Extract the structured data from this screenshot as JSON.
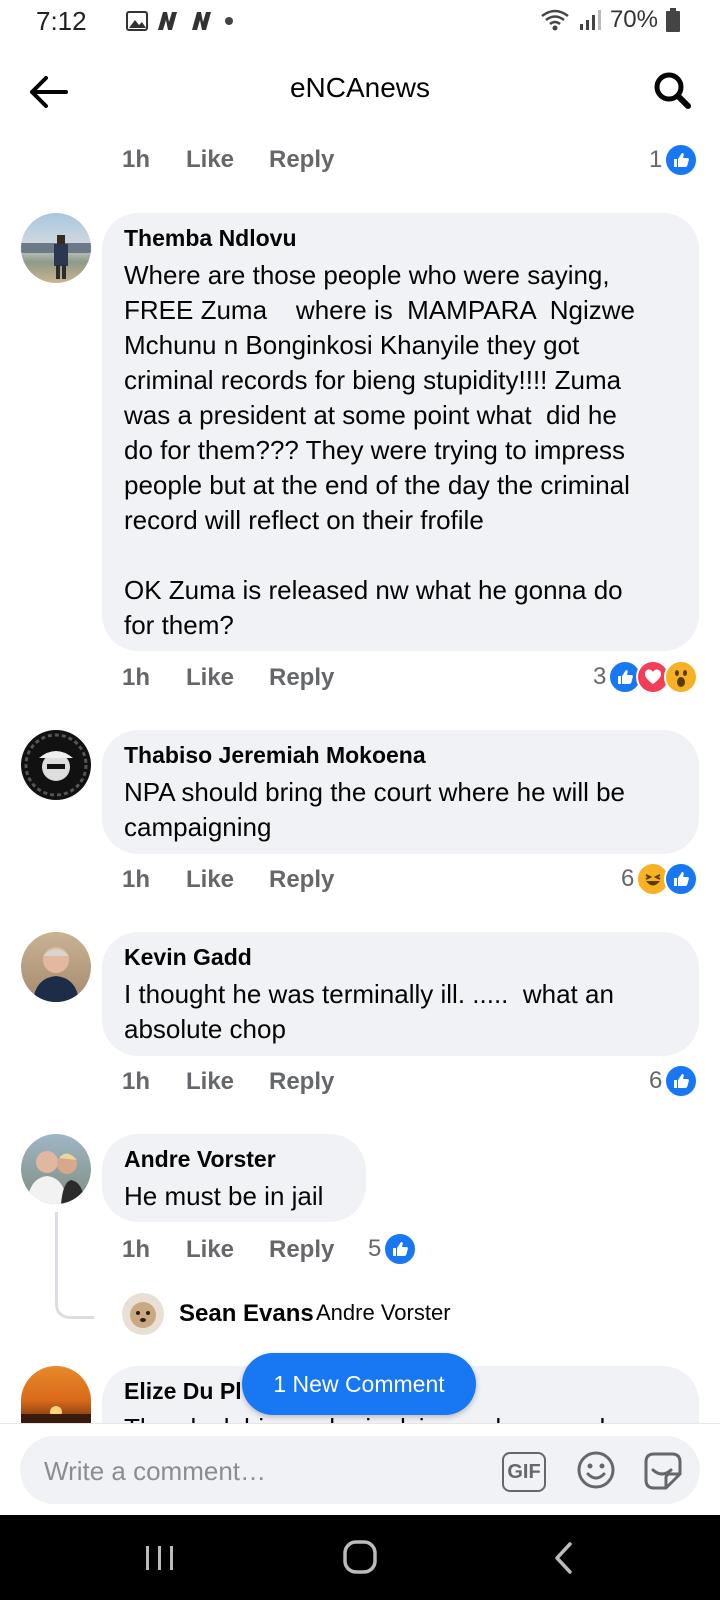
{
  "status_bar": {
    "time": "7:12",
    "battery": "70%"
  },
  "header": {
    "title": "eNCAnews"
  },
  "actions": {
    "like_label": "Like",
    "reply_label": "Reply"
  },
  "top_meta": {
    "time": "1h",
    "reaction_count": "1"
  },
  "comments": [
    {
      "author": "Themba Ndlovu",
      "text": "Where are those people who were saying,\nFREE Zuma    where is  MAMPARA  Ngizwe\nMchunu n Bonginkosi Khanyile they got\ncriminal records for bieng stupidity!!!! Zuma\nwas a president at some point what  did he\ndo for them??? They were trying to impress\npeople but at the end of the day the criminal\nrecord will reflect on their frofile\n\nOK Zuma is released nw what he gonna do\nfor them?",
      "time": "1h",
      "reaction_count": "3",
      "reactions": [
        "like",
        "love",
        "wow"
      ]
    },
    {
      "author": "Thabiso Jeremiah Mokoena",
      "text": "NPA should bring the court where he will be\ncampaigning",
      "time": "1h",
      "reaction_count": "6",
      "reactions": [
        "haha",
        "like"
      ]
    },
    {
      "author": "Kevin Gadd",
      "text": "I thought he was terminally ill. .....  what an\nabsolute chop",
      "time": "1h",
      "reaction_count": "6",
      "reactions": [
        "like"
      ]
    },
    {
      "author": "Andre Vorster",
      "text": "He must be in jail",
      "time": "1h",
      "reaction_count": "5",
      "reactions": [
        "like"
      ]
    },
    {
      "author": "Elize Du Pl",
      "text": "Then lock him up he is dying so how can he"
    }
  ],
  "reply_preview": {
    "author": "Sean Evans",
    "text": "Andre Vorster"
  },
  "new_comment_pill": "1 New Comment",
  "composer": {
    "placeholder": "Write a comment…",
    "gif_label": "GIF"
  }
}
